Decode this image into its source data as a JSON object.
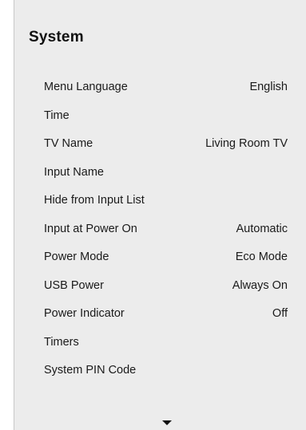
{
  "panel": {
    "title": "System"
  },
  "menu": [
    {
      "label": "Menu Language",
      "value": "English"
    },
    {
      "label": "Time",
      "value": ""
    },
    {
      "label": "TV Name",
      "value": "Living Room TV"
    },
    {
      "label": "Input Name",
      "value": ""
    },
    {
      "label": "Hide from Input List",
      "value": ""
    },
    {
      "label": "Input at Power On",
      "value": "Automatic"
    },
    {
      "label": "Power Mode",
      "value": "Eco Mode"
    },
    {
      "label": "USB Power",
      "value": "Always On"
    },
    {
      "label": "Power Indicator",
      "value": "Off"
    },
    {
      "label": "Timers",
      "value": ""
    },
    {
      "label": "System PIN Code",
      "value": ""
    }
  ],
  "icons": {
    "scroll_down": "chevron-down-icon"
  },
  "colors": {
    "panel_background": "#ececec",
    "text": "#1a1a1a"
  }
}
